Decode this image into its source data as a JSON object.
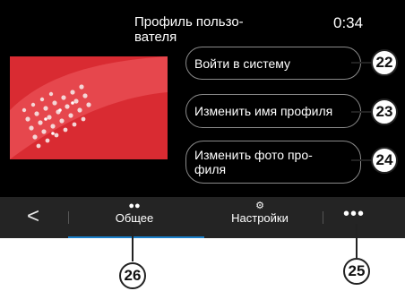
{
  "header": {
    "title": "Профиль пользо-\nвателя",
    "clock": "0:34"
  },
  "actions": [
    {
      "label": "Войти в систему",
      "callout": "22"
    },
    {
      "label": "Изменить имя профиля",
      "callout": "23"
    },
    {
      "label": "Изменить фото про-\nфиля",
      "callout": "24"
    }
  ],
  "tabbar": {
    "back_icon": "<",
    "tabs": [
      {
        "label": "Общее",
        "icon": "people-icon",
        "callout": "26"
      },
      {
        "label": "Настройки",
        "icon": "gear-icon"
      }
    ],
    "more_icon": "•••",
    "more_callout": "25"
  },
  "colors": {
    "accent": "#1a7fc9",
    "image": "#d92b32"
  }
}
